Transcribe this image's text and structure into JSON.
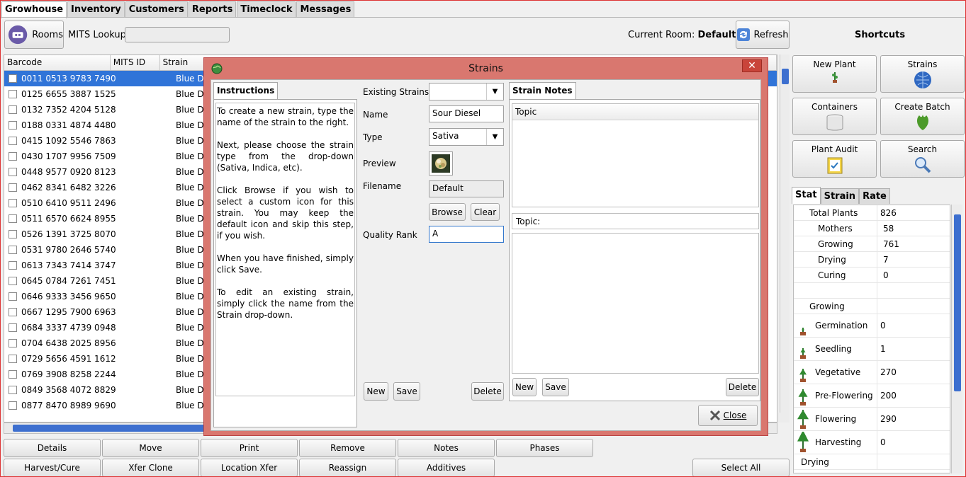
{
  "tabs": [
    "Growhouse",
    "Inventory",
    "Customers",
    "Reports",
    "Timeclock",
    "Messages"
  ],
  "toolbar": {
    "rooms": "Rooms",
    "mits_lookup": "MITS Lookup",
    "current_room_label": "Current Room:",
    "current_room_value": "Default",
    "refresh": "Refresh",
    "shortcuts_title": "Shortcuts"
  },
  "grid": {
    "headers": [
      "Barcode",
      "MITS ID",
      "Strain"
    ],
    "rows": [
      {
        "barcode": "0011 0513 9783 7490",
        "strain": "Blue Dream"
      },
      {
        "barcode": "0125 6655 3887 1525",
        "strain": "Blue Dream"
      },
      {
        "barcode": "0132 7352 4204 5128",
        "strain": "Blue Dream"
      },
      {
        "barcode": "0188 0331 4874 4480",
        "strain": "Blue Dream"
      },
      {
        "barcode": "0415 1092 5546 7863",
        "strain": "Blue Dream"
      },
      {
        "barcode": "0430 1707 9956 7509",
        "strain": "Blue Dream"
      },
      {
        "barcode": "0448 9577 0920 8123",
        "strain": "Blue Dream"
      },
      {
        "barcode": "0462 8341 6482 3226",
        "strain": "Blue Dream"
      },
      {
        "barcode": "0510 6410 9511 2496",
        "strain": "Blue Dream"
      },
      {
        "barcode": "0511 6570 6624 8955",
        "strain": "Blue Dream"
      },
      {
        "barcode": "0526 1391 3725 8070",
        "strain": "Blue Dream"
      },
      {
        "barcode": "0531 9780 2646 5740",
        "strain": "Blue Dream"
      },
      {
        "barcode": "0613 7343 7414 3747",
        "strain": "Blue Dream"
      },
      {
        "barcode": "0645 0784 7261 7451",
        "strain": "Blue Dream"
      },
      {
        "barcode": "0646 9333 3456 9650",
        "strain": "Blue Dream"
      },
      {
        "barcode": "0667 1295 7900 6963",
        "strain": "Blue Dream"
      },
      {
        "barcode": "0684 3337 4739 0948",
        "strain": "Blue Dream"
      },
      {
        "barcode": "0704 6438 2025 8956",
        "strain": "Blue Dream"
      },
      {
        "barcode": "0729 5656 4591 1612",
        "strain": "Blue Dream"
      },
      {
        "barcode": "0769 3908 8258 2244",
        "strain": "Blue Dream"
      },
      {
        "barcode": "0849 3568 4072 8829",
        "strain": "Blue Dream"
      },
      {
        "barcode": "0877 8470 8989 9690",
        "strain": "Blue Dream"
      }
    ]
  },
  "bottom_buttons_row1": [
    "Details",
    "Move",
    "Print",
    "Remove",
    "Notes",
    "Phases"
  ],
  "bottom_buttons_row2": [
    "Harvest/Cure",
    "Xfer Clone",
    "Location Xfer",
    "Reassign",
    "Additives"
  ],
  "select_all": "Select All",
  "dialog": {
    "title": "Strains",
    "instructions_tab": "Instructions",
    "instructions_paragraphs": [
      "To create a new strain, type the name of the strain to the right.",
      "Next, please choose the strain type from the drop-down (Sativa, Indica, etc).",
      "Click Browse if you wish to select a custom icon for this strain. You may keep the default icon and skip this step, if you wish.",
      "When you have finished, simply click Save.",
      "To edit an existing strain, simply click the name from the Strain drop-down."
    ],
    "existing_strains_label": "Existing Strains",
    "existing_strains_value": "",
    "name_label": "Name",
    "name_value": "Sour Diesel",
    "type_label": "Type",
    "type_value": "Sativa",
    "preview_label": "Preview",
    "filename_label": "Filename",
    "filename_value": "Default",
    "browse": "Browse",
    "clear": "Clear",
    "quality_label": "Quality Rank",
    "quality_value": "A",
    "new": "New",
    "save": "Save",
    "delete": "Delete",
    "notes_tab": "Strain Notes",
    "topic_header": "Topic",
    "topic_label": "Topic:",
    "notes_new": "New",
    "notes_save": "Save",
    "notes_delete": "Delete",
    "close": "Close"
  },
  "shortcuts": [
    {
      "label": "New Plant",
      "icon": "plant-icon"
    },
    {
      "label": "Strains",
      "icon": "globe-icon"
    },
    {
      "label": "Containers",
      "icon": "container-icon"
    },
    {
      "label": "Create Batch",
      "icon": "leaf-icon"
    },
    {
      "label": "Plant Audit",
      "icon": "clipboard-icon"
    },
    {
      "label": "Search",
      "icon": "magnifier-icon"
    }
  ],
  "stat_tabs": [
    "Stat",
    "Strain",
    "Rate"
  ],
  "stats": {
    "total": {
      "label": "Total Plants",
      "value": "826"
    },
    "phases": [
      {
        "label": "Mothers",
        "value": "58"
      },
      {
        "label": "Growing",
        "value": "761"
      },
      {
        "label": "Drying",
        "value": "7"
      },
      {
        "label": "Curing",
        "value": "0"
      }
    ],
    "growing_header": "Growing",
    "growing": [
      {
        "label": "Germination",
        "value": "0"
      },
      {
        "label": "Seedling",
        "value": "1"
      },
      {
        "label": "Vegetative",
        "value": "270"
      },
      {
        "label": "Pre-Flowering",
        "value": "200"
      },
      {
        "label": "Flowering",
        "value": "290"
      },
      {
        "label": "Harvesting",
        "value": "0"
      }
    ],
    "drying_header": "Drying"
  }
}
